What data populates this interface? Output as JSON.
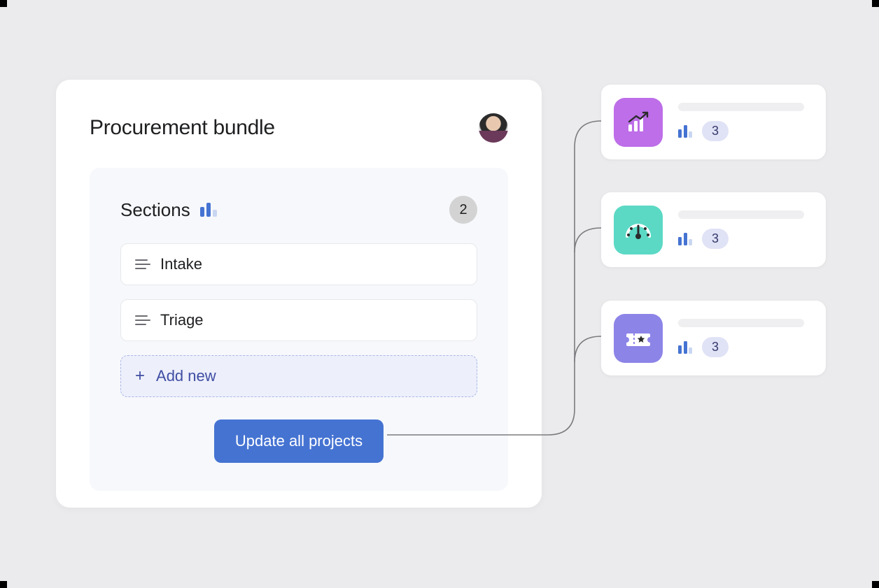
{
  "panel": {
    "title": "Procurement bundle"
  },
  "sections": {
    "heading": "Sections",
    "count": "2",
    "items": [
      "Intake",
      "Triage"
    ],
    "addLabel": "Add new"
  },
  "updateButton": "Update all projects",
  "projects": [
    {
      "icon": "growth-chart",
      "count": "3"
    },
    {
      "icon": "gauge",
      "count": "3"
    },
    {
      "icon": "ticket",
      "count": "3"
    }
  ]
}
